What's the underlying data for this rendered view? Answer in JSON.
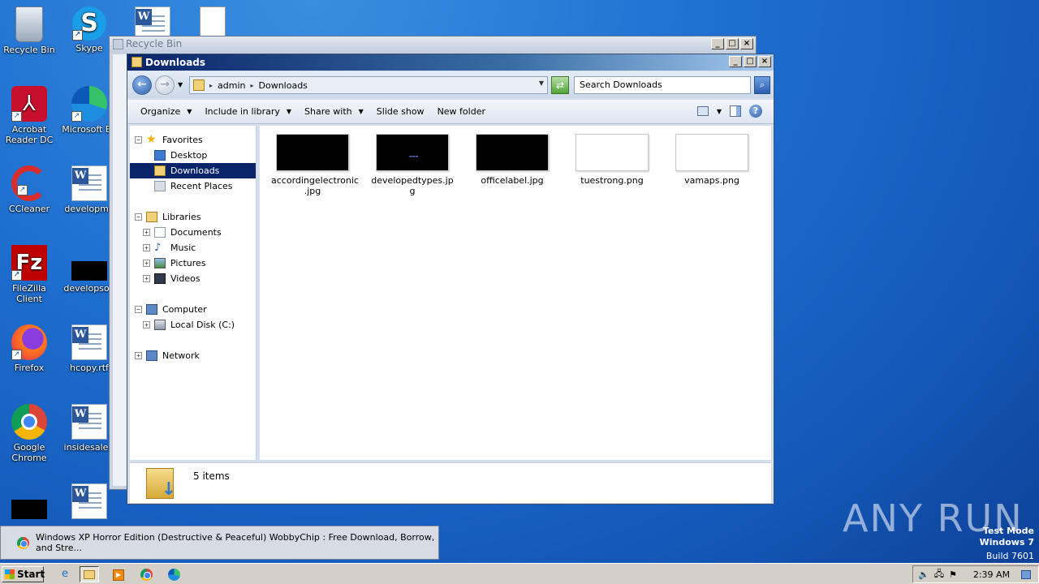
{
  "desktop": {
    "icons": [
      {
        "label": "Recycle Bin"
      },
      {
        "label": "Skype"
      },
      {
        "label": "Acrobat Reader DC"
      },
      {
        "label": "Microsoft Ed"
      },
      {
        "label": "CCleaner"
      },
      {
        "label": "developme"
      },
      {
        "label": "FileZilla Client"
      },
      {
        "label": "developsou"
      },
      {
        "label": "Firefox"
      },
      {
        "label": "hcopy.rtf"
      },
      {
        "label": "Google Chrome"
      },
      {
        "label": "insidesale.r"
      }
    ]
  },
  "back_window": {
    "title": "Recycle Bin"
  },
  "explorer": {
    "title": "Downloads",
    "breadcrumb": [
      "admin",
      "Downloads"
    ],
    "search_placeholder": "Search Downloads",
    "commands": {
      "organize": "Organize",
      "include": "Include in library",
      "share": "Share with",
      "slideshow": "Slide show",
      "newfolder": "New folder"
    },
    "nav": {
      "favorites": "Favorites",
      "desktop": "Desktop",
      "downloads": "Downloads",
      "recent": "Recent Places",
      "libraries": "Libraries",
      "documents": "Documents",
      "music": "Music",
      "pictures": "Pictures",
      "videos": "Videos",
      "computer": "Computer",
      "localdisk": "Local Disk (C:)",
      "network": "Network"
    },
    "files": [
      {
        "name1": "accordingelectronic",
        "name2": ".jpg",
        "kind": "dark"
      },
      {
        "name1": "developedtypes.jp",
        "name2": "g",
        "kind": "dark"
      },
      {
        "name1": "officelabel.jpg",
        "name2": "",
        "kind": "dark"
      },
      {
        "name1": "tuestrong.png",
        "name2": "",
        "kind": "light"
      },
      {
        "name1": "vamaps.png",
        "name2": "",
        "kind": "light"
      }
    ],
    "status": "5 items"
  },
  "popup": {
    "text": "Windows XP Horror Edition (Destructive & Peaceful) WobbyChip : Free Download, Borrow, and Stre..."
  },
  "taskbar": {
    "start": "Start",
    "clock": "2:39 AM"
  },
  "watermark": {
    "line1": "Test Mode",
    "line2": "Windows 7",
    "line3": "Build 7601",
    "brand": "ANY RUN"
  }
}
